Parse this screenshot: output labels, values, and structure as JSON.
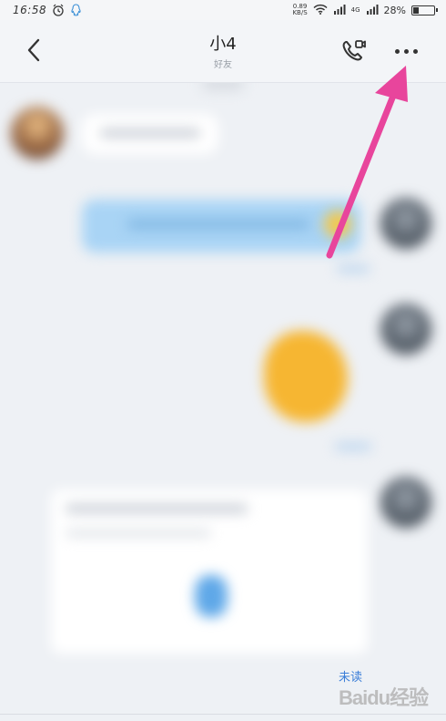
{
  "status_bar": {
    "time": "16:58",
    "net_speed_value": "0.89",
    "net_speed_unit": "KB/S",
    "network_label": "4G",
    "battery": "28%",
    "battery_level": 0.28
  },
  "header": {
    "title": "小4",
    "subtitle": "好友"
  },
  "chat": {
    "unread_label": "未读"
  },
  "watermark": {
    "text": "Baidu经验"
  },
  "colors": {
    "arrow": "#e8459c",
    "background": "#eef1f5",
    "sent_bubble": "#a9d4f5"
  }
}
